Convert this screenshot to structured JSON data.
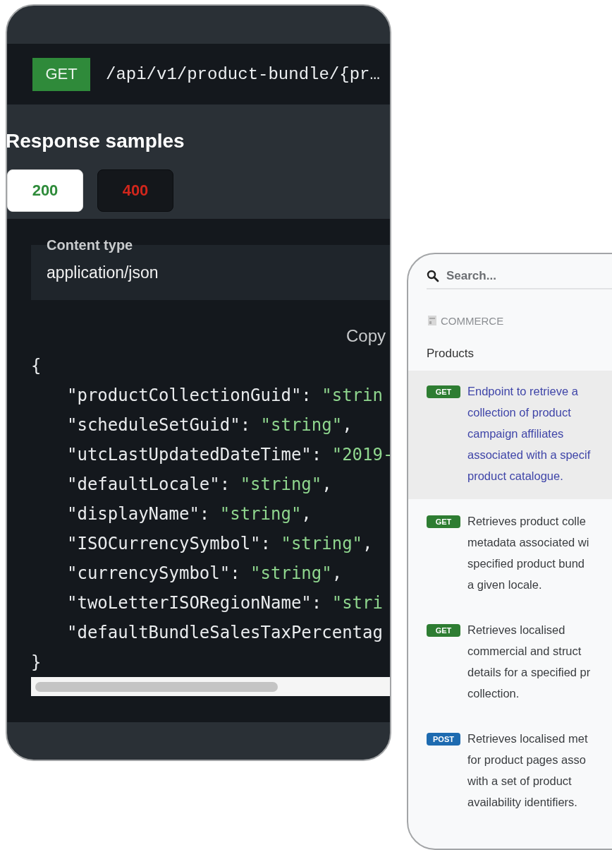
{
  "response_panel": {
    "endpoint": {
      "method": "GET",
      "path": "/api/v1/product-bundle/{pr…"
    },
    "heading": "Response samples",
    "tabs": [
      {
        "label": "200",
        "selected": true,
        "color": "#2e8b3a"
      },
      {
        "label": "400",
        "selected": false,
        "color": "#d0261c"
      }
    ],
    "content_type": {
      "label": "Content type",
      "value": "application/json"
    },
    "copy": "Copy",
    "code": {
      "open": "{",
      "close": "}",
      "lines": [
        {
          "key": "\"productCollectionGuid\": ",
          "value": "\"strin"
        },
        {
          "key": "\"scheduleSetGuid\": ",
          "value": "\"string\"",
          "punct": ","
        },
        {
          "key": "\"utcLastUpdatedDateTime\": ",
          "value": "\"2019-"
        },
        {
          "key": "\"defaultLocale\": ",
          "value": "\"string\"",
          "punct": ","
        },
        {
          "key": "\"displayName\": ",
          "value": "\"string\"",
          "punct": ","
        },
        {
          "key": "\"ISOCurrencySymbol\": ",
          "value": "\"string\"",
          "punct": ","
        },
        {
          "key": "\"currencySymbol\": ",
          "value": "\"string\"",
          "punct": ","
        },
        {
          "key": "\"twoLetterISORegionName\": ",
          "value": "\"stri"
        },
        {
          "key": "\"defaultBundleSalesTaxPercentag"
        }
      ]
    }
  },
  "sidebar": {
    "search": {
      "placeholder": "Search..."
    },
    "section": "COMMERCE",
    "group": "Products",
    "items": [
      {
        "method": "GET",
        "color": "#2e7d32",
        "selected": true,
        "lines": [
          "Endpoint to retrieve a",
          "collection of product",
          "campaign affiliates",
          "associated with a specif",
          "product catalogue."
        ]
      },
      {
        "method": "GET",
        "color": "#2e7d32",
        "selected": false,
        "lines": [
          "Retrieves product colle",
          "metadata associated wi",
          "specified product bund",
          "a given locale."
        ]
      },
      {
        "method": "GET",
        "color": "#2e7d32",
        "selected": false,
        "lines": [
          "Retrieves localised",
          "commercial and struct",
          "details for a specified pr",
          "collection."
        ]
      },
      {
        "method": "POST",
        "color": "#1e6bb0",
        "selected": false,
        "lines": [
          "Retrieves localised met",
          "for product pages asso",
          "with a set of product",
          "availability identifiers."
        ]
      }
    ]
  }
}
